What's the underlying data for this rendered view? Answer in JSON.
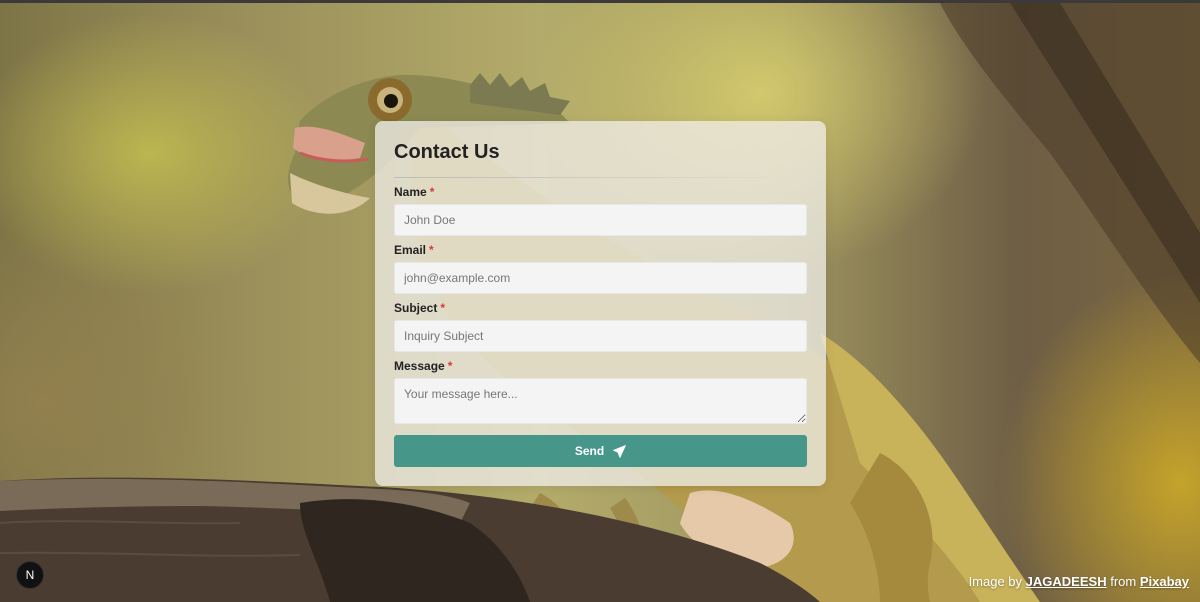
{
  "form": {
    "title": "Contact Us",
    "required_mark": "*",
    "fields": [
      {
        "label": "Name",
        "placeholder": "John Doe",
        "value": ""
      },
      {
        "label": "Email",
        "placeholder": "john@example.com",
        "value": ""
      },
      {
        "label": "Subject",
        "placeholder": "Inquiry Subject",
        "value": ""
      },
      {
        "label": "Message",
        "placeholder": "Your message here...",
        "value": ""
      }
    ],
    "send_label": "Send",
    "send_icon": "paper-plane-icon",
    "accent_color": "#46978a"
  },
  "corner_badge": {
    "text": "N",
    "icon": "nextjs-logo-icon"
  },
  "credit": {
    "prefix": "Image by",
    "author": "JAGADEESH",
    "middle": "from",
    "source": "Pixabay"
  }
}
